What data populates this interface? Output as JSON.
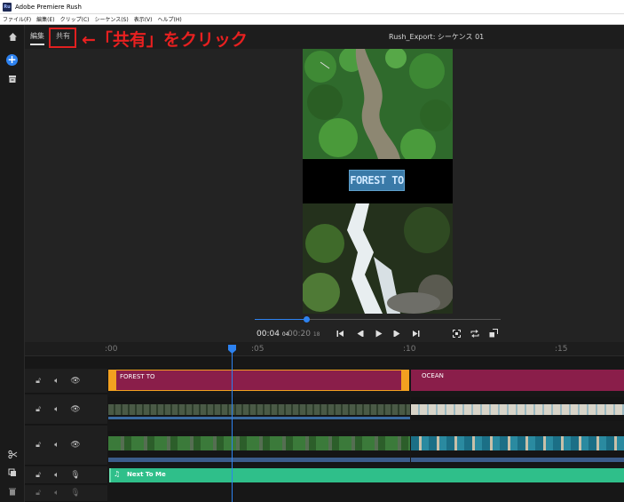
{
  "window": {
    "title": "Adobe Premiere Rush",
    "app_icon": "Ru"
  },
  "menu": [
    "ファイル(F)",
    "編集(E)",
    "クリップ(C)",
    "シーケンス(S)",
    "表示(V)",
    "ヘルプ(H)"
  ],
  "nav": {
    "edit_tab": "編集",
    "share_tab": "共有",
    "sequence_title": "Rush_Export: シーケンス 01"
  },
  "annotation": {
    "text": "←「共有」をクリック",
    "color": "#e02020"
  },
  "preview": {
    "title_text": "FOREST TO",
    "time_current": "00:04",
    "time_current_frames": "04",
    "time_total": "00:20",
    "time_total_frames": "18",
    "progress_fraction": 0.21
  },
  "ruler": {
    "ticks": [
      ":00",
      ":05",
      ":10",
      ":15"
    ]
  },
  "timeline": {
    "title_clips": [
      {
        "label": "FOREST TO",
        "selected": true
      },
      {
        "label": "OCEAN",
        "selected": false
      }
    ],
    "audio_clip": {
      "label": "Next To Me"
    }
  },
  "colors": {
    "accent": "#2d82f0",
    "title_clip": "#8a1e4a",
    "handle": "#f2a020",
    "audio": "#2fbf8a"
  }
}
